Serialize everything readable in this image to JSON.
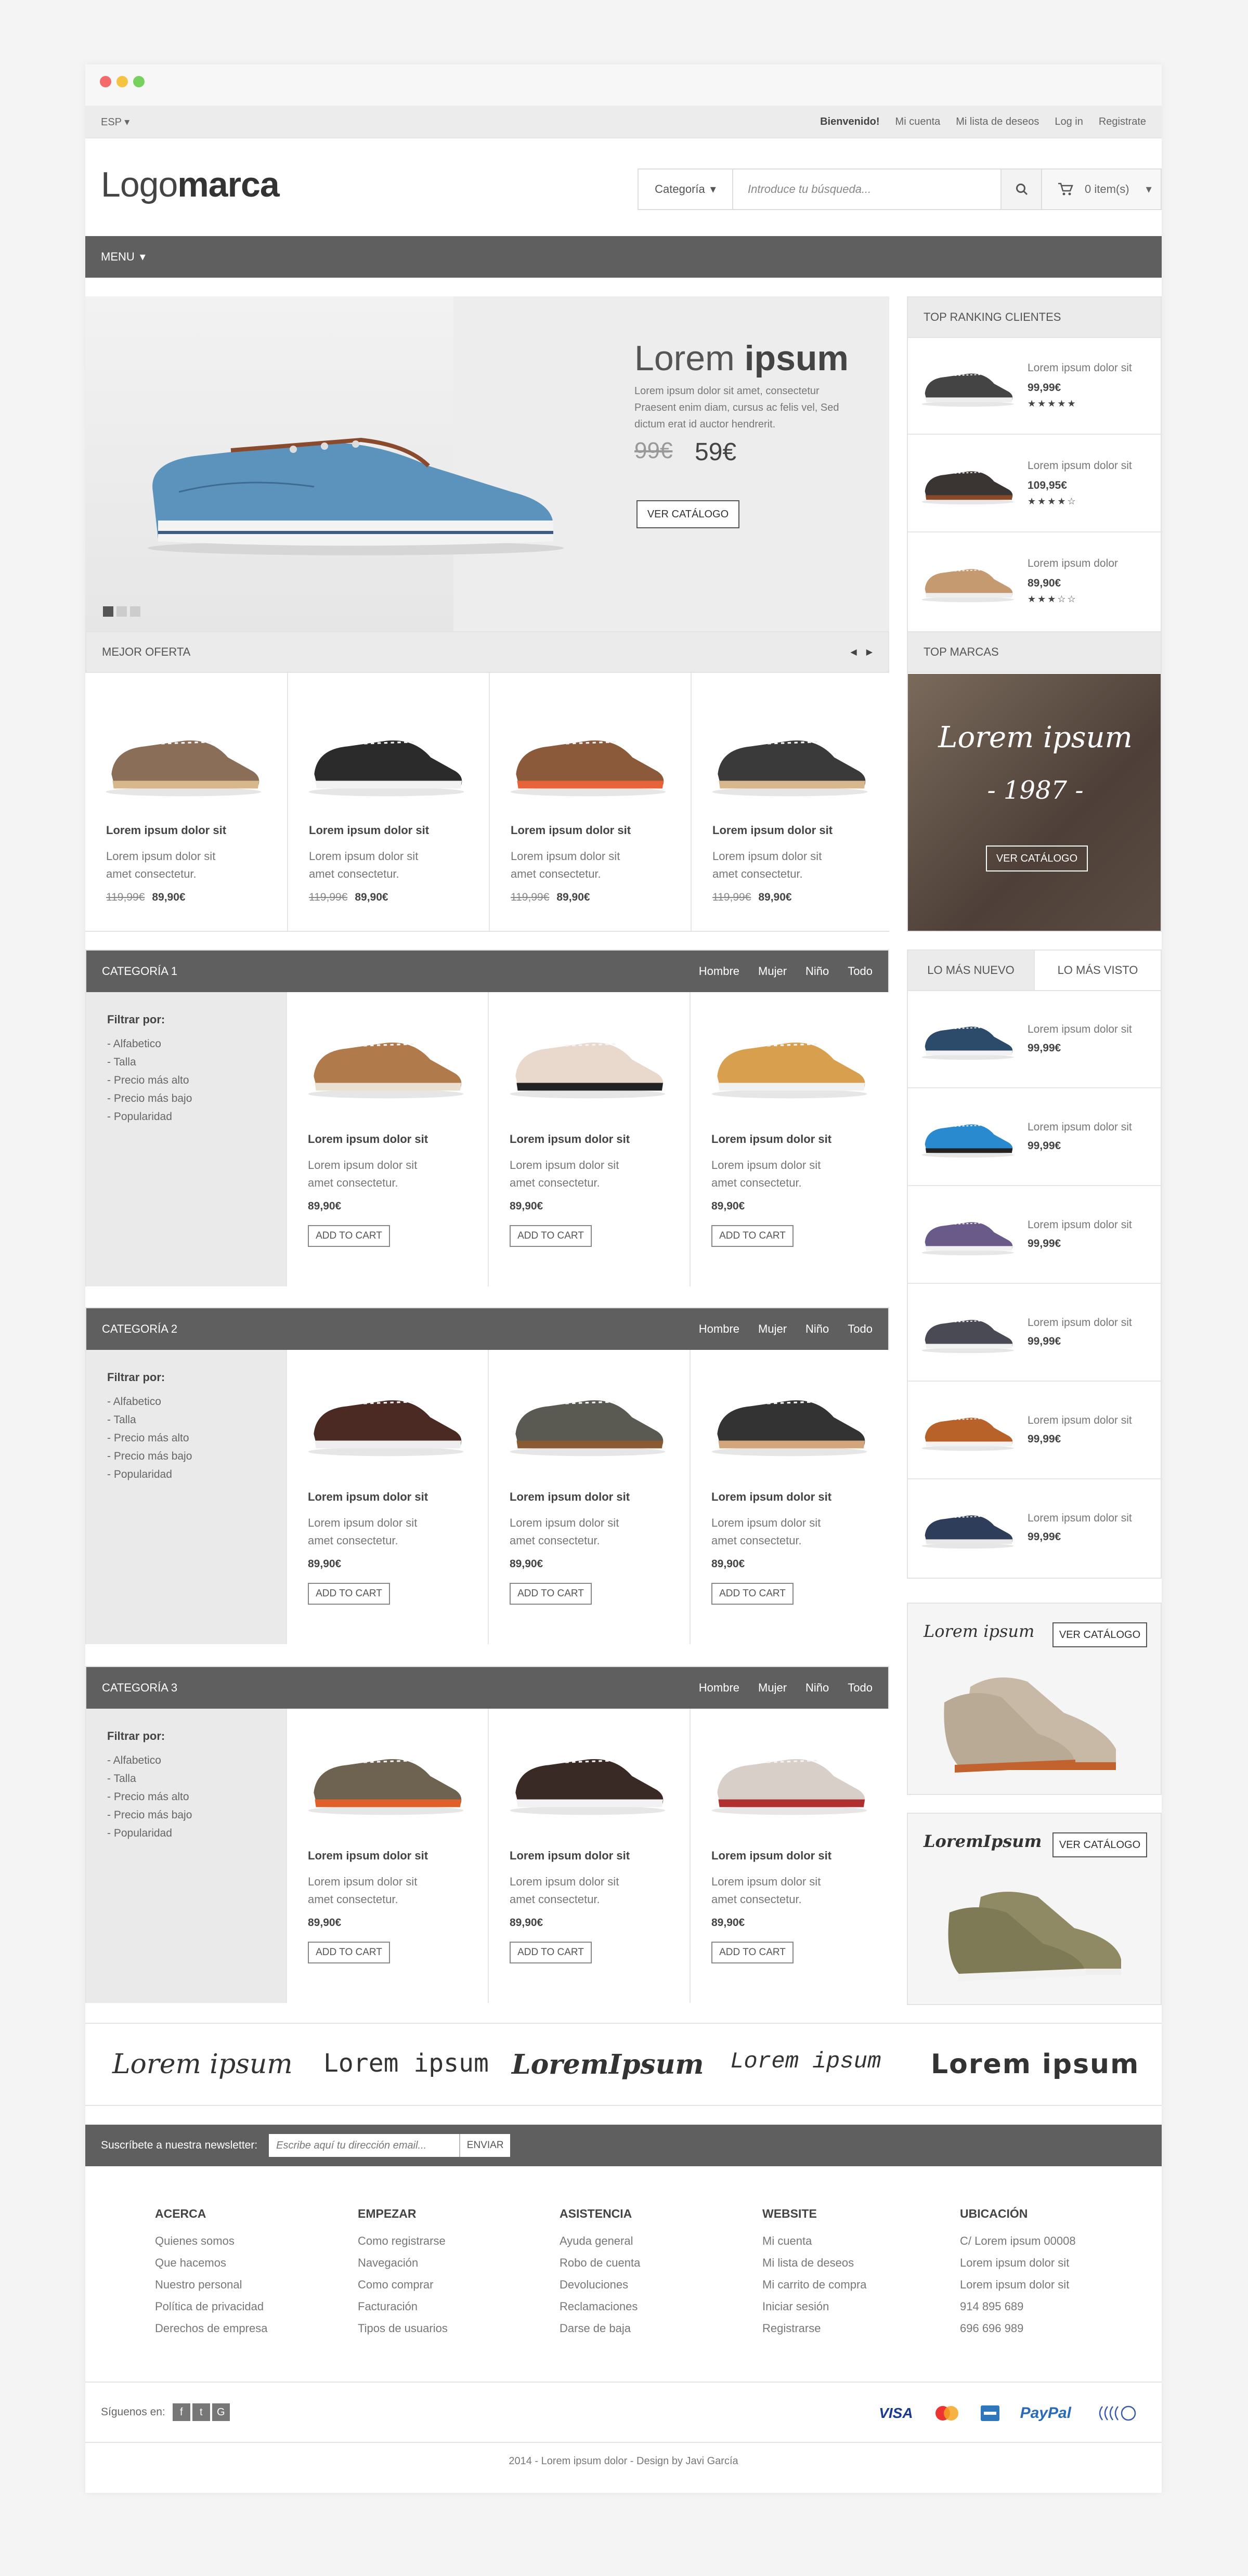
{
  "topbar": {
    "lang": "ESP",
    "welcome": "Bienvenido!",
    "links": [
      "Mi cuenta",
      "Mi lista de deseos",
      "Log in",
      "Registrate"
    ]
  },
  "header": {
    "logo_light": "Logo",
    "logo_bold": "marca",
    "search_category": "Categoría",
    "search_placeholder": "Introduce tu búsqueda...",
    "cart_label": "0 item(s)"
  },
  "menu": {
    "label": "MENU"
  },
  "hero": {
    "title_light": "Lorem ",
    "title_bold": "ipsum",
    "desc": "Lorem ipsum dolor sit amet, consectetur Praesent enim diam, cursus ac felis vel, Sed dictum erat id auctor hendrerit.",
    "old_price": "99€",
    "new_price": "59€",
    "button": "VER CATÁLOGO"
  },
  "best_offer": {
    "title": "MEJOR OFERTA",
    "items": [
      {
        "name": "Lorem ipsum dolor sit",
        "desc": "Lorem ipsum dolor sit amet consectetur.",
        "old": "119,99€",
        "price": "89,90€"
      },
      {
        "name": "Lorem ipsum dolor sit",
        "desc": "Lorem ipsum dolor sit amet consectetur.",
        "old": "119,99€",
        "price": "89,90€"
      },
      {
        "name": "Lorem ipsum dolor sit",
        "desc": "Lorem ipsum dolor sit amet consectetur.",
        "old": "119,99€",
        "price": "89,90€"
      },
      {
        "name": "Lorem ipsum dolor sit",
        "desc": "Lorem ipsum dolor sit amet consectetur.",
        "old": "119,99€",
        "price": "89,90€"
      }
    ]
  },
  "filters": {
    "title": "Filtrar por:",
    "items": [
      "- Alfabetico",
      "- Talla",
      "- Precio más alto",
      "- Precio más bajo",
      "- Popularidad"
    ],
    "tabs": [
      "Hombre",
      "Mujer",
      "Niño",
      "Todo"
    ]
  },
  "categories": [
    {
      "title": "CATEGORÍA 1",
      "items": [
        {
          "name": "Lorem ipsum dolor sit",
          "desc": "Lorem ipsum dolor sit amet consectetur.",
          "price": "89,90€",
          "btn": "ADD TO CART"
        },
        {
          "name": "Lorem ipsum dolor sit",
          "desc": "Lorem ipsum dolor sit amet consectetur.",
          "price": "89,90€",
          "btn": "ADD TO CART"
        },
        {
          "name": "Lorem ipsum dolor sit",
          "desc": "Lorem ipsum dolor sit amet consectetur.",
          "price": "89,90€",
          "btn": "ADD TO CART"
        }
      ]
    },
    {
      "title": "CATEGORÍA 2",
      "items": [
        {
          "name": "Lorem ipsum dolor sit",
          "desc": "Lorem ipsum dolor sit amet consectetur.",
          "price": "89,90€",
          "btn": "ADD TO CART"
        },
        {
          "name": "Lorem ipsum dolor sit",
          "desc": "Lorem ipsum dolor sit amet consectetur.",
          "price": "89,90€",
          "btn": "ADD TO CART"
        },
        {
          "name": "Lorem ipsum dolor sit",
          "desc": "Lorem ipsum dolor sit amet consectetur.",
          "price": "89,90€",
          "btn": "ADD TO CART"
        }
      ]
    },
    {
      "title": "CATEGORÍA 3",
      "items": [
        {
          "name": "Lorem ipsum dolor sit",
          "desc": "Lorem ipsum dolor sit amet consectetur.",
          "price": "89,90€",
          "btn": "ADD TO CART"
        },
        {
          "name": "Lorem ipsum dolor sit",
          "desc": "Lorem ipsum dolor sit amet consectetur.",
          "price": "89,90€",
          "btn": "ADD TO CART"
        },
        {
          "name": "Lorem ipsum dolor sit",
          "desc": "Lorem ipsum dolor sit amet consectetur.",
          "price": "89,90€",
          "btn": "ADD TO CART"
        }
      ]
    }
  ],
  "ranking": {
    "title": "TOP RANKING CLIENTES",
    "items": [
      {
        "name": "Lorem ipsum dolor sit",
        "price": "99,99€",
        "stars": "★★★★★"
      },
      {
        "name": "Lorem ipsum dolor sit",
        "price": "109,95€",
        "stars": "★★★★☆"
      },
      {
        "name": "Lorem ipsum dolor",
        "price": "89,90€",
        "stars": "★★★☆☆"
      }
    ]
  },
  "top_brands": {
    "title": "TOP MARCAS",
    "script": "Lorem ipsum",
    "year": "- 1987 -",
    "button": "VER CATÁLOGO"
  },
  "newest": {
    "tab_new": "LO MÁS NUEVO",
    "tab_seen": "LO MÁS VISTO",
    "items": [
      {
        "name": "Lorem ipsum dolor sit",
        "price": "99,99€"
      },
      {
        "name": "Lorem ipsum dolor sit",
        "price": "99,99€"
      },
      {
        "name": "Lorem ipsum dolor sit",
        "price": "99,99€"
      },
      {
        "name": "Lorem ipsum dolor sit",
        "price": "99,99€"
      },
      {
        "name": "Lorem ipsum dolor sit",
        "price": "99,99€"
      },
      {
        "name": "Lorem ipsum dolor sit",
        "price": "99,99€"
      }
    ]
  },
  "promo1": {
    "brand": "Lorem ipsum",
    "button": "VER CATÁLOGO"
  },
  "promo2": {
    "brand": "LoremIpsum",
    "button": "VER CATÁLOGO"
  },
  "brands": [
    "Lorem ipsum",
    "Lorem ipsum",
    "LoremIpsum",
    "Lorem ipsum",
    "Lorem ipsum"
  ],
  "newsletter": {
    "label": "Suscríbete a nuestra newsletter:",
    "placeholder": "Escribe aquí tu dirección email...",
    "button": "ENVIAR"
  },
  "footer": {
    "cols": [
      {
        "title": "ACERCA",
        "links": [
          "Quienes somos",
          "Que hacemos",
          "Nuestro personal",
          "Política de privacidad",
          "Derechos de empresa"
        ]
      },
      {
        "title": "EMPEZAR",
        "links": [
          "Como registrarse",
          "Navegación",
          "Como comprar",
          "Facturación",
          "Tipos de usuarios"
        ]
      },
      {
        "title": "ASISTENCIA",
        "links": [
          "Ayuda general",
          "Robo de cuenta",
          "Devoluciones",
          "Reclamaciones",
          "Darse de baja"
        ]
      },
      {
        "title": "WEBSITE",
        "links": [
          "Mi cuenta",
          "Mi lista de deseos",
          "Mi carrito de compra",
          "Iniciar sesión",
          "Registrarse"
        ]
      },
      {
        "title": "UBICACIÓN",
        "links": [
          "C/ Lorem ipsum 00008",
          "Lorem ipsum dolor sit",
          "Lorem ipsum dolor sit",
          "914 895 689",
          "696 696 989"
        ]
      }
    ],
    "follow": "Síguenos en:",
    "social": [
      "f",
      "t",
      "G"
    ],
    "payments": [
      "VISA",
      "PayPal"
    ],
    "copyright": "2014 - Lorem ipsum dolor - Design by Javi García"
  },
  "colors": {
    "dark_bar": "#5f5f5f",
    "panel_head": "#ebebeb",
    "visa": "#1a3a8f",
    "paypal": "#2a6ab8"
  }
}
